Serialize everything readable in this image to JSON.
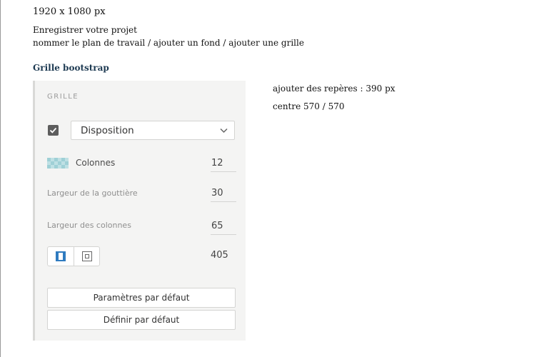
{
  "notes": {
    "resolution": "1920 x 1080 px",
    "save_project": "Enregistrer votre projet",
    "steps": "nommer le plan de travail / ajouter un fond / ajouter une grille",
    "heading": "Grille bootstrap",
    "guides": "ajouter des repères : 390 px",
    "centre": "centre 570 / 570"
  },
  "grid_panel": {
    "title": "GRILLE",
    "enabled": true,
    "layout_select": {
      "value": "Disposition",
      "icon": "chevron-down-icon"
    },
    "columns": {
      "label": "Colonnes",
      "value": "12",
      "icon": "columns-grid-icon"
    },
    "gutter_width": {
      "label": "Largeur de la gouttière",
      "value": "30"
    },
    "column_width": {
      "label": "Largeur des colonnes",
      "value": "65"
    },
    "mode_buttons": {
      "icons": [
        "column-mode-icon",
        "square-mode-icon"
      ],
      "active": 0,
      "accent": "#2f7bc0"
    },
    "total_width": "405",
    "reset_button": "Paramètres par défaut",
    "set_default_button": "Définir par défaut"
  }
}
